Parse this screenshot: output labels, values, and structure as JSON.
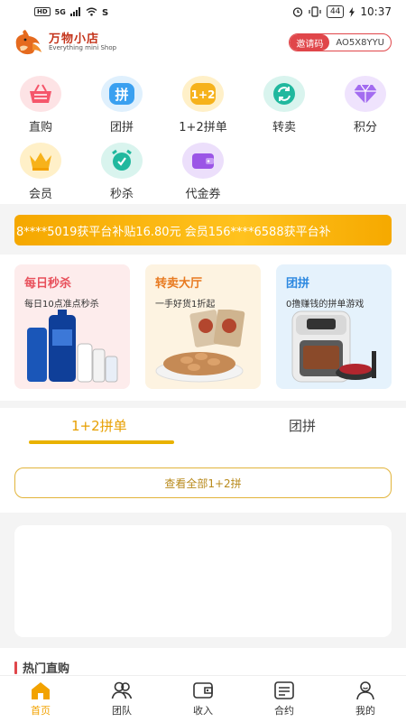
{
  "status_bar": {
    "signal_left": "HD",
    "network": "5G",
    "battery": "44",
    "time": "10:37"
  },
  "header": {
    "logo_cn": "万物小店",
    "logo_en": "Everything mini Shop",
    "invite_label": "邀请码",
    "invite_code": "AO5X8YYU"
  },
  "icon_grid": [
    {
      "label": "直购",
      "icon": "basket-icon",
      "color": "#f5566b",
      "bg": "#fde3e5"
    },
    {
      "label": "团拼",
      "icon": "pin-badge-icon",
      "color": "#3aa0f0",
      "bg": "#dff0fd"
    },
    {
      "label": "1+2拼单",
      "icon": "one-plus-two-icon",
      "color": "#f6b21b",
      "bg": "#fff0c8"
    },
    {
      "label": "转卖",
      "icon": "exchange-icon",
      "color": "#20b89e",
      "bg": "#d9f4ee"
    },
    {
      "label": "积分",
      "icon": "diamond-icon",
      "color": "#a36cf0",
      "bg": "#efe3fd"
    },
    {
      "label": "会员",
      "icon": "crown-icon",
      "color": "#f7b21b",
      "bg": "#fff0c8"
    },
    {
      "label": "秒杀",
      "icon": "alarm-clock-icon",
      "color": "#20b89e",
      "bg": "#d9f4ee"
    },
    {
      "label": "代金券",
      "icon": "wallet-icon",
      "color": "#9b55e6",
      "bg": "#ecdffb"
    }
  ],
  "marquee": {
    "text": "8****5019获平台补贴16.80元    会员156****6588获平台补"
  },
  "promos": [
    {
      "title": "每日秒杀",
      "subtitle": "每日10点准点秒杀",
      "title_color": "#e8505b",
      "bg": "#fdecec",
      "image": "shampoo-bottles-icon"
    },
    {
      "title": "转卖大厅",
      "subtitle": "一手好货1折起",
      "title_color": "#e87a20",
      "bg": "#fdf3e1",
      "image": "nuts-plate-icon"
    },
    {
      "title": "团拼",
      "subtitle": "0撸赚钱的拼单游戏",
      "title_color": "#2c88e0",
      "bg": "#e5f2fc",
      "image": "air-fryer-icon"
    }
  ],
  "tabs": [
    {
      "label": "1+2拼单",
      "active": true
    },
    {
      "label": "团拼",
      "active": false
    }
  ],
  "view_all_label": "查看全部1+2拼",
  "hot_section_title": "热门直购",
  "tabbar": [
    {
      "label": "首页",
      "icon": "home-icon",
      "active": true
    },
    {
      "label": "团队",
      "icon": "team-icon",
      "active": false
    },
    {
      "label": "收入",
      "icon": "income-wallet-icon",
      "active": false
    },
    {
      "label": "合约",
      "icon": "contract-icon",
      "active": false
    },
    {
      "label": "我的",
      "icon": "profile-icon",
      "active": false
    }
  ],
  "colors": {
    "accent": "#f2a200",
    "invite_red": "#e0464a",
    "marquee": "#f8b100"
  }
}
